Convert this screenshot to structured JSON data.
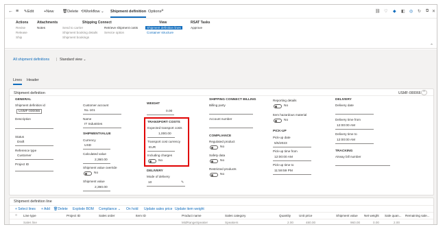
{
  "toolbar": {
    "back": "←",
    "menu": "≡",
    "edit": "Edit",
    "new": "New",
    "delete": "Delete",
    "workflow": "Workflow",
    "tab_active": "Shipment definition",
    "options": "Options"
  },
  "ribbon": {
    "groups": [
      {
        "header": "Actions",
        "items": [
          "Revise",
          "Release",
          "Ship"
        ]
      },
      {
        "header": "Attachments",
        "items": [
          "Notes"
        ]
      },
      {
        "header": "Shipping Connect",
        "items": [
          "Send to carrier",
          "Shipment booking details",
          "Shipment bookings",
          "Retrieve shipment costs",
          "Service option"
        ]
      },
      {
        "header": "View",
        "items": [
          "Shipment definition lines",
          "Container structure"
        ]
      },
      {
        "header": "RSAT Tasks",
        "items": [
          "Approve"
        ]
      }
    ]
  },
  "breadcrumb": {
    "all": "All shipment definitions",
    "view": "Standard view"
  },
  "tabs": {
    "lines": "Lines",
    "header": "Header"
  },
  "card": {
    "title": "Shipment definition",
    "id_right": "USMF-000066"
  },
  "general": {
    "header": "GENERAL",
    "id_label": "Shipment definition id",
    "id_value": "USMF-000066",
    "description_label": "Description",
    "status_label": "Status",
    "status_value": "Draft",
    "reftype_label": "Reference type",
    "reftype_value": "Customer",
    "project_label": "Project ID"
  },
  "customer": {
    "account_label": "Customer account",
    "account_value": "NL-101",
    "name_label": "Name",
    "name_value": "IT Industries"
  },
  "shipvalue": {
    "header": "SHIPMENTVALUE",
    "currency_label": "Currency",
    "currency_value": "USD",
    "calc_label": "Calculated value",
    "calc_value": "2,360.00",
    "override_label": "Shipment value override",
    "override_value": "No",
    "value_label": "Shipment value",
    "value_value": "2,360.00"
  },
  "weight": {
    "header": "WEIGHT",
    "value": "0.00"
  },
  "transport": {
    "header": "TRANSPORT COSTS",
    "expected_label": "Expected transport costs",
    "expected_value": "1,000.00",
    "currency_label": "Transport cost currency",
    "currency_value": "EUR",
    "including_label": "Including charges",
    "including_value": "No"
  },
  "delivery_left": {
    "header": "DELIVERY",
    "mode_label": "Mode of delivery",
    "mode_value": "10"
  },
  "billing": {
    "header": "SHIPPING CONNECT BILLING",
    "party_label": "Billing party",
    "account_label": "Account number"
  },
  "compliance": {
    "header": "COMPLIANCE",
    "regulated_label": "Regulated product",
    "regulated_value": "No",
    "safety_label": "Safety data",
    "safety_value": "No",
    "restricted_label": "Restricted products",
    "restricted_value": "No"
  },
  "reporting": {
    "details_label": "Reporting details",
    "details_value": "No",
    "hazard_label": "Item hazardous material",
    "hazard_value": "No"
  },
  "pickup": {
    "header": "PICK-UP",
    "date_label": "Pick-up date",
    "date_value": "5/5/2023",
    "from_label": "Pick-up time from",
    "from_value": "12:00:00 AM",
    "to_label": "Pick-up time to",
    "to_value": "11:59:59 PM"
  },
  "delivery_right": {
    "header": "DELIVERY",
    "date_label": "Delivery date",
    "from_label": "Delivery time from",
    "from_value": "12:00:00 AM",
    "to_label": "Delivery time to",
    "to_value": "12:00:00 AM"
  },
  "tracking": {
    "header": "TRACKING",
    "bill_label": "Airway bill number"
  },
  "lines": {
    "title": "Shipment definition line",
    "actions": [
      "+ Select lines",
      "+ Add",
      "Delete",
      "Explode BOM",
      "Compliance",
      "On hold",
      "Update sales price",
      "Update item weight"
    ],
    "columns": [
      "Line type",
      "Project ID",
      "Sales order",
      "Item ID",
      "Product name",
      "Sales category",
      "Quantity",
      "Unit price",
      "Shipment value",
      "Net weight",
      "Sale quan...",
      "Remaining sale..."
    ],
    "row": [
      "Sales line",
      "",
      "",
      "",
      "MidRangeSpeaker",
      "Speakers",
      "2.00",
      "480.00",
      "960.00",
      "0.00",
      "2.00",
      ""
    ]
  }
}
